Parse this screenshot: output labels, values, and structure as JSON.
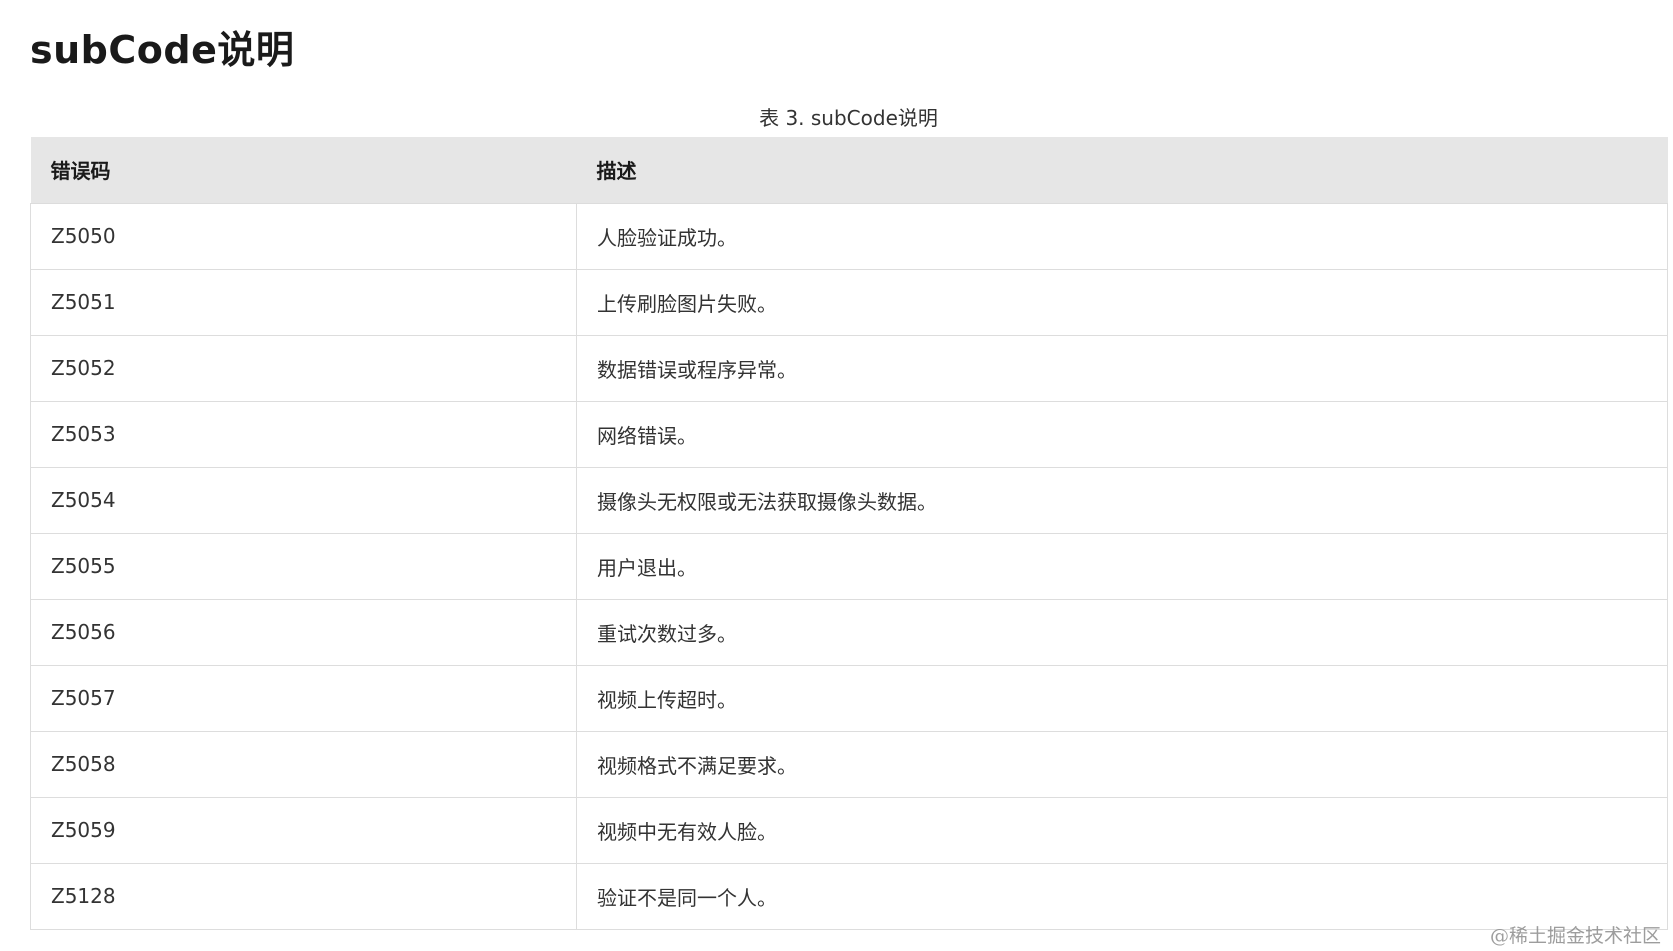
{
  "page": {
    "title": "subCode说明",
    "caption": "表 3. subCode说明",
    "watermark": "@稀土掘金技术社区"
  },
  "table": {
    "headers": [
      "错误码",
      "描述"
    ],
    "rows": [
      [
        "Z5050",
        "人脸验证成功。"
      ],
      [
        "Z5051",
        "上传刷脸图片失败。"
      ],
      [
        "Z5052",
        "数据错误或程序异常。"
      ],
      [
        "Z5053",
        "网络错误。"
      ],
      [
        "Z5054",
        "摄像头无权限或无法获取摄像头数据。"
      ],
      [
        "Z5055",
        "用户退出。"
      ],
      [
        "Z5056",
        "重试次数过多。"
      ],
      [
        "Z5057",
        "视频上传超时。"
      ],
      [
        "Z5058",
        "视频格式不满足要求。"
      ],
      [
        "Z5059",
        "视频中无有效人脸。"
      ],
      [
        "Z5128",
        "验证不是同一个人。"
      ]
    ]
  },
  "colors": {
    "header_bg": "#e6e6e6",
    "border": "#dddddd",
    "text": "#333333"
  }
}
